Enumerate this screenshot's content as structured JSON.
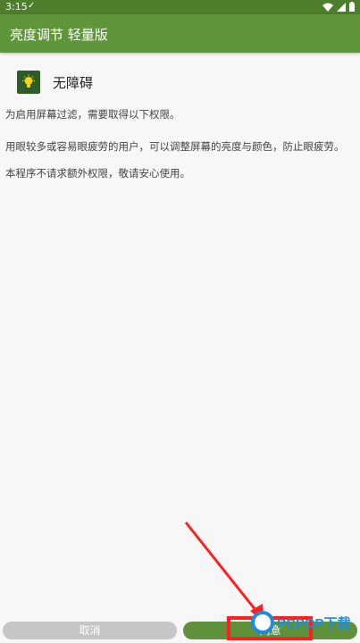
{
  "status": {
    "time": "3:15"
  },
  "toolbar": {
    "title": "亮度调节 轻量版"
  },
  "permission": {
    "title": "无障碍",
    "intro": "为启用屏幕过滤，需要取得以下权限。",
    "desc": "用眼较多或容易眼疲劳的用户，可以调整屏幕的亮度与颜色，防止眼疲劳。",
    "note": "本程序不请求额外权限，敬请安心使用。"
  },
  "buttons": {
    "cancel": "取消",
    "agree": "同意"
  },
  "watermark": {
    "text": "PCPOP下载"
  },
  "colors": {
    "primary": "#5f9639",
    "status_bar": "#4e7e2c",
    "highlight": "#ff1f1f"
  }
}
